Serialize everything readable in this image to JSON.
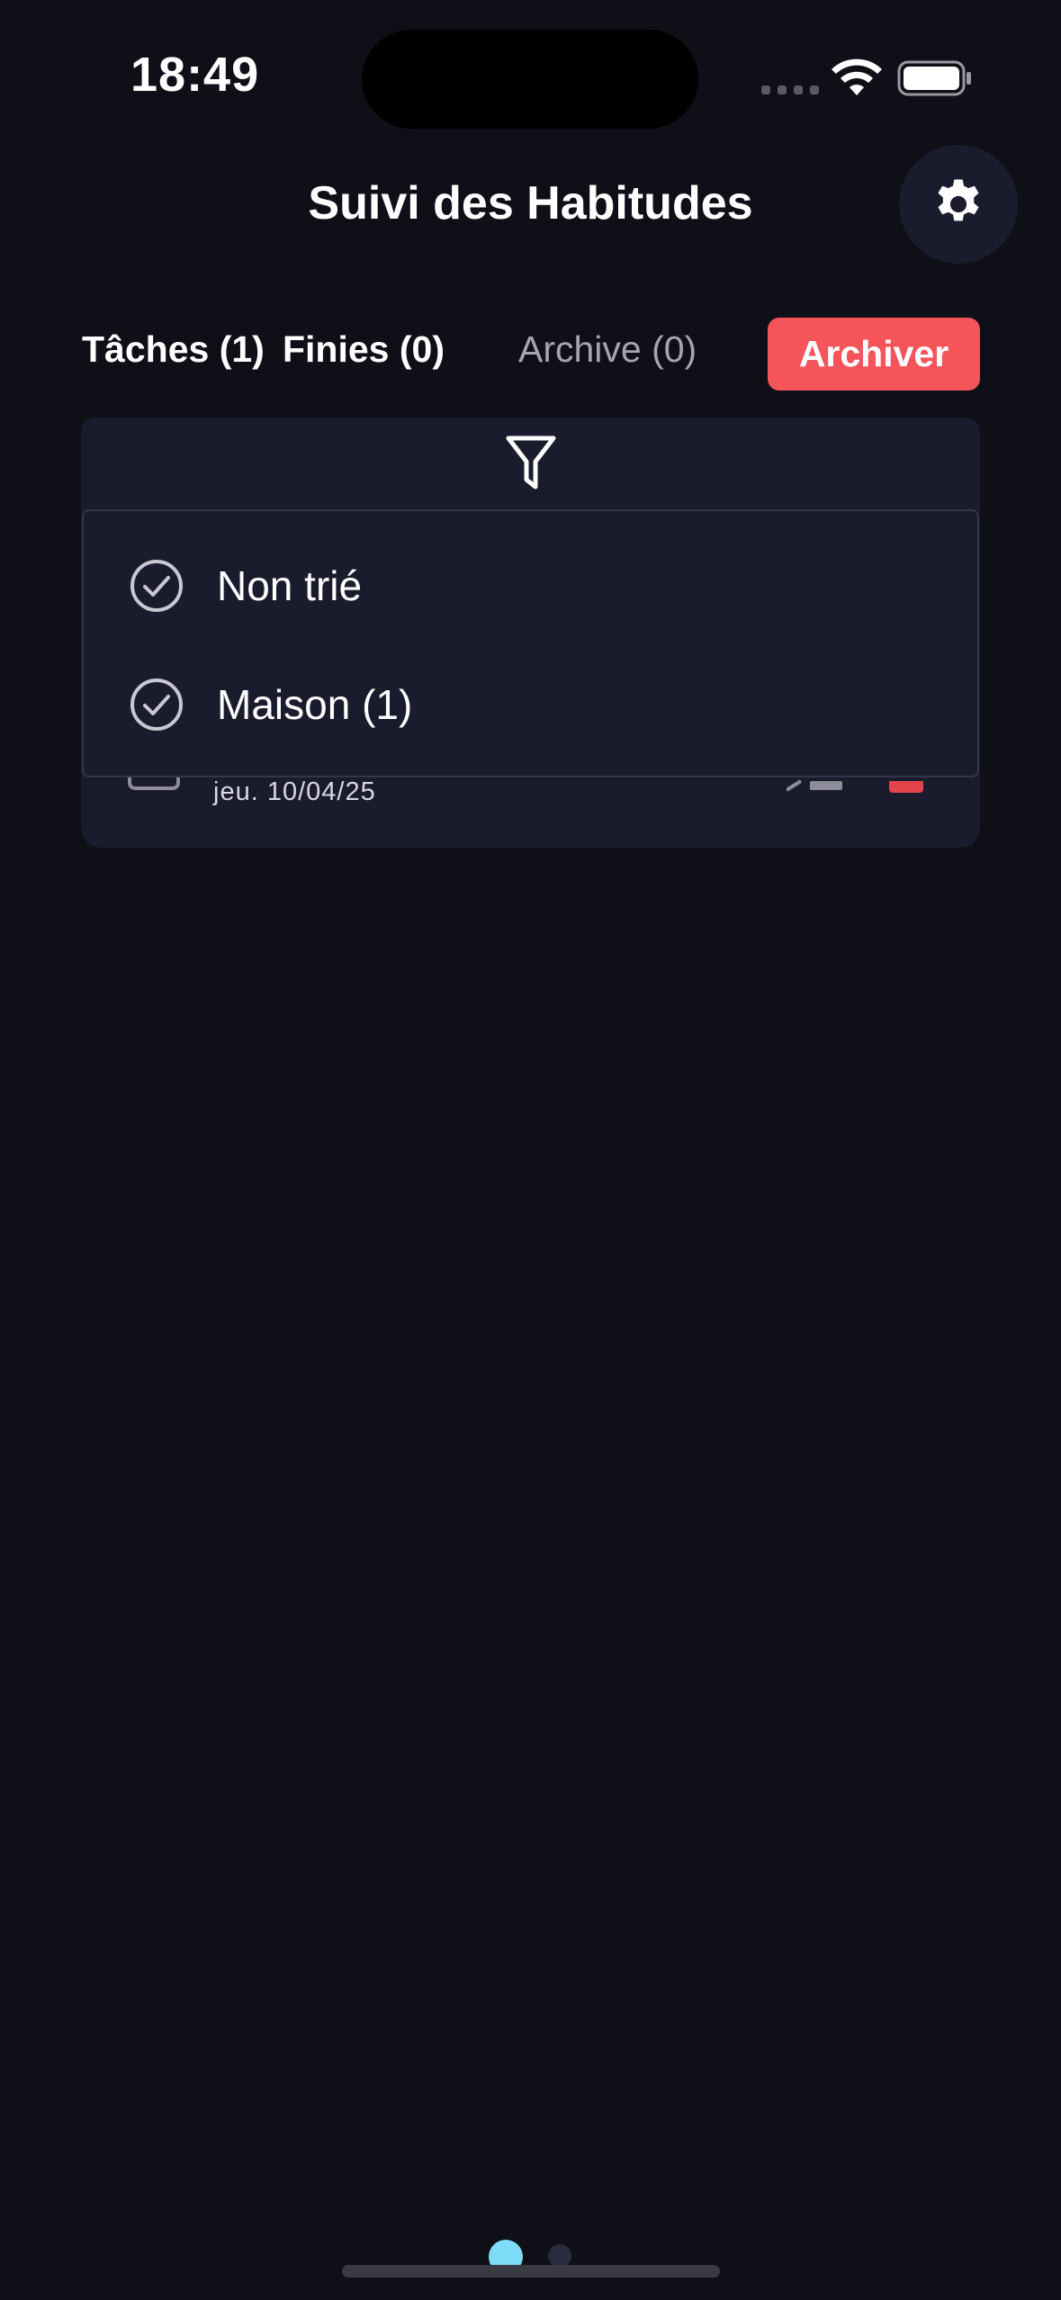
{
  "status_bar": {
    "time": "18:49",
    "icons": [
      "cellular-signal-icon",
      "wifi-icon",
      "battery-icon"
    ]
  },
  "header": {
    "title": "Suivi des Habitudes",
    "settings_icon": "gear-icon"
  },
  "tabs": [
    {
      "label": "Tâches (1)",
      "active": true
    },
    {
      "label": "Finies (0)",
      "active": true
    },
    {
      "label": "Archive (0)",
      "active": false
    }
  ],
  "archive_button": {
    "label": "Archiver",
    "color": "#f4545a"
  },
  "filter": {
    "icon": "filter-funnel-icon",
    "options": [
      {
        "label": "Non trié",
        "icon": "check-circle-icon"
      },
      {
        "label": "Maison (1)",
        "icon": "check-circle-icon"
      }
    ]
  },
  "task": {
    "date": "jeu. 10/04/25"
  },
  "pager": {
    "pages": 2,
    "current": 1,
    "accent": "#7fdcf8"
  },
  "colors": {
    "background": "#0f0f18",
    "card": "#1b1b2e",
    "inactive_text": "#a4a4b2"
  }
}
